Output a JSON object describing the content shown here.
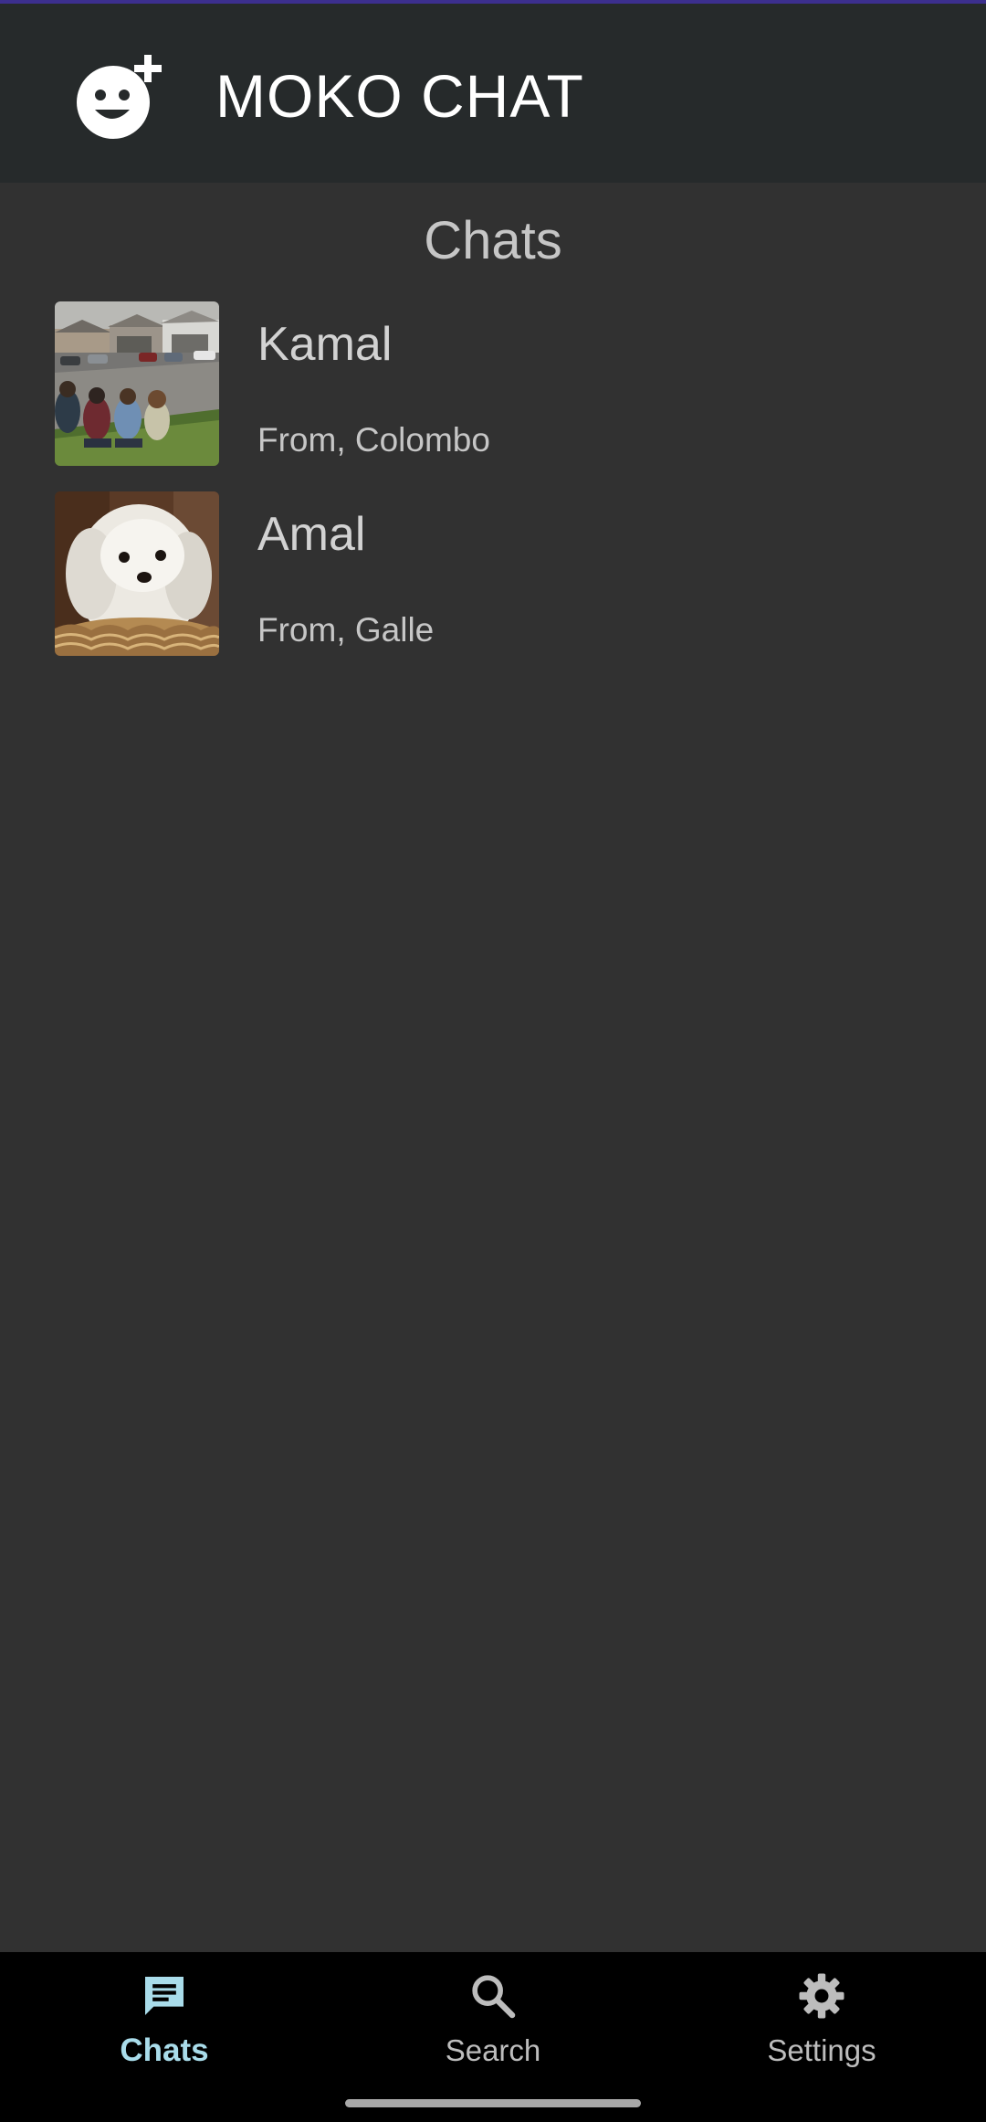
{
  "app_bar": {
    "title": "MOKO CHAT",
    "logo_icon": "face-add-icon",
    "background": "#262a2b",
    "accent": "#3c2f8e"
  },
  "section_title": "Chats",
  "chats": [
    {
      "name": "Kamal",
      "subtitle": "From, Colombo",
      "avatar": "group-photo"
    },
    {
      "name": "Amal",
      "subtitle": "From, Galle",
      "avatar": "puppy-photo"
    }
  ],
  "bottom_nav": {
    "items": [
      {
        "label": "Chats",
        "icon": "chat-icon",
        "active": true
      },
      {
        "label": "Search",
        "icon": "search-icon",
        "active": false
      },
      {
        "label": "Settings",
        "icon": "gear-icon",
        "active": false
      }
    ],
    "active_color": "#a9dcea"
  },
  "colors": {
    "background": "#313131",
    "nav_background": "#000000"
  }
}
